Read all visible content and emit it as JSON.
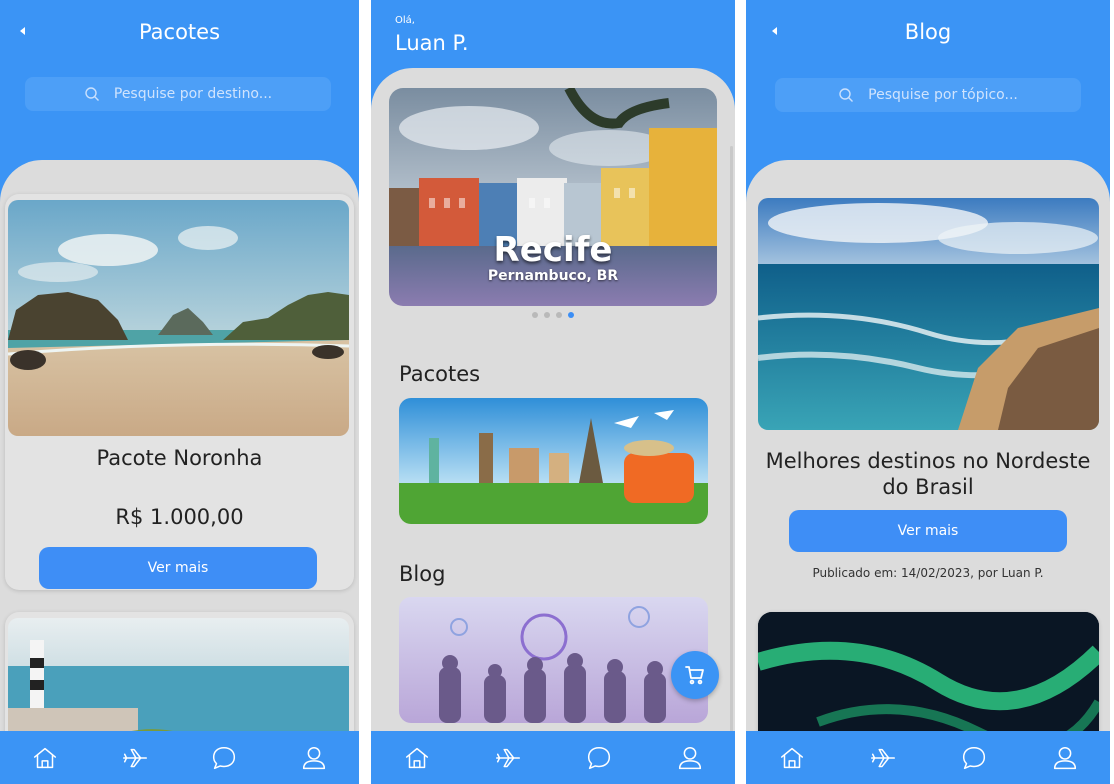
{
  "screens": {
    "packages": {
      "title": "Pacotes",
      "search_placeholder": "Pesquise por destino...",
      "card": {
        "name": "Pacote Noronha",
        "price": "R$ 1.000,00",
        "button": "Ver mais"
      }
    },
    "home": {
      "greeting": "Olá,",
      "user_name": "Luan P.",
      "carousel": {
        "city": "Recife",
        "region": "Pernambuco, BR",
        "dot_count": 4,
        "active_dot": 4
      },
      "sections": {
        "packages": "Pacotes",
        "blog": "Blog"
      }
    },
    "blog": {
      "title": "Blog",
      "search_placeholder": "Pesquise por tópico...",
      "post": {
        "title": "Melhores destinos no Nordeste do Brasil",
        "button": "Ver mais",
        "meta": "Publicado em: 14/02/2023, por Luan P."
      }
    }
  },
  "nav_icons": [
    "home-icon",
    "flights-icon",
    "chat-icon",
    "profile-icon"
  ],
  "colors": {
    "primary": "#3b94f5",
    "button": "#3e8ef6",
    "sheet": "#dcdcdc"
  }
}
